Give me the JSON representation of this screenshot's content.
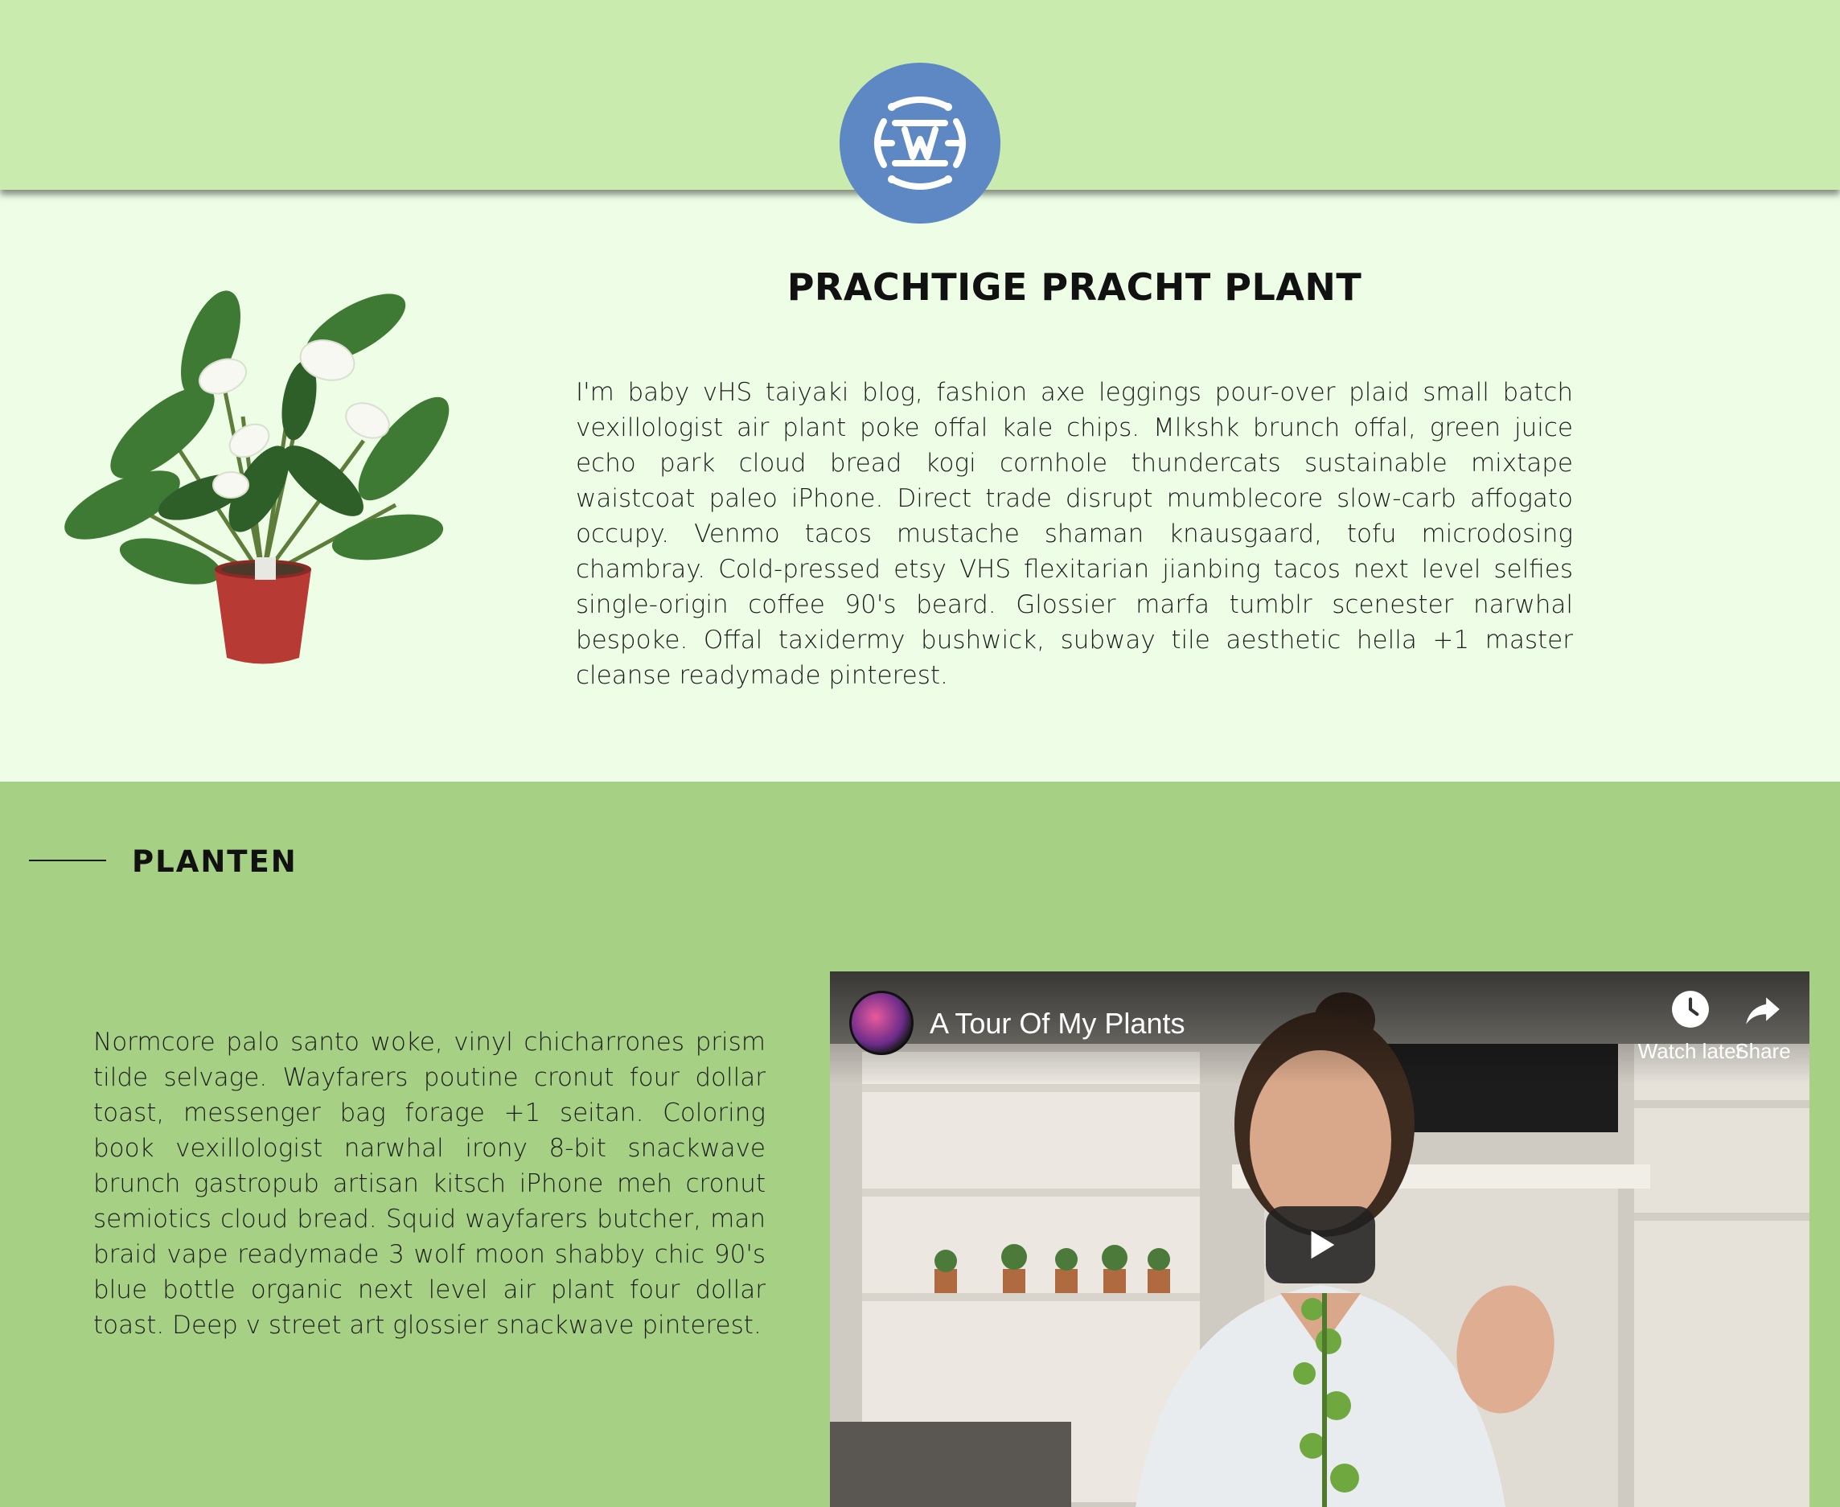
{
  "header": {
    "logo_icon": "w-monogram-logo"
  },
  "hero": {
    "image_icon": "potted-anthurium-plant",
    "title": "PRACHTIGE PRACHT PLANT",
    "body": "I'm baby vHS taiyaki blog, fashion axe leggings pour-over plaid small batch vexillologist air plant poke offal kale chips. Mlkshk brunch offal, green juice echo park cloud bread kogi cornhole thundercats sustainable mixtape waistcoat paleo iPhone. Direct trade disrupt mumblecore slow-carb affogato occupy. Venmo tacos mustache shaman knausgaard, tofu microdosing chambray. Cold-pressed etsy VHS flexitarian jianbing tacos next level selfies single-origin coffee 90's beard. Glossier marfa tumblr scenester narwhal bespoke. Offal taxidermy bushwick, subway tile aesthetic hella +1 master cleanse readymade pinterest."
  },
  "planten": {
    "title": "PLANTEN",
    "body": "Normcore palo santo woke, vinyl chicharrones prism tilde selvage. Wayfarers poutine cronut four dollar toast, messenger bag forage +1 seitan. Coloring book vexillologist narwhal irony 8-bit snackwave brunch gastropub artisan kitsch iPhone meh cronut semiotics cloud bread. Squid wayfarers butcher, man braid vape readymade 3 wolf moon shabby chic 90's blue bottle organic next level air plant four dollar toast. Deep v street art glossier snackwave pinterest."
  },
  "video": {
    "title": "A Tour Of My Plants",
    "watch_later_label": "Watch later",
    "share_label": "Share",
    "icons": {
      "watch_later": "clock-icon",
      "share": "share-arrow-icon",
      "play": "play-icon"
    }
  },
  "colors": {
    "header_bg": "#c9ecae",
    "hero_bg": "#edfde6",
    "section_bg": "#a6d185",
    "logo_bg": "#5e88c3"
  }
}
